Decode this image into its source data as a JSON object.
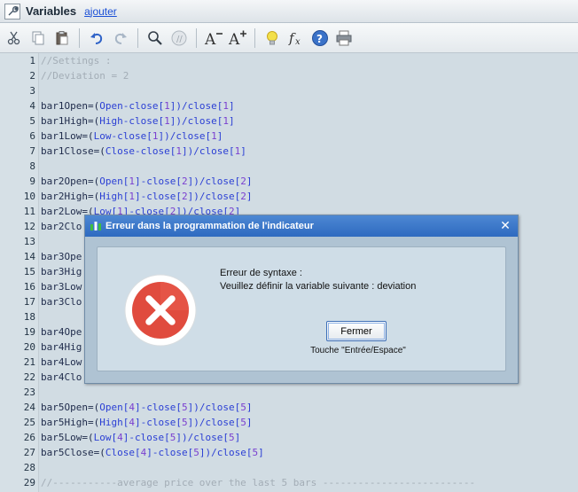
{
  "window": {
    "title": "Variables",
    "add_link": "ajouter"
  },
  "toolbar": {
    "buttons": [
      {
        "icon": "scissors-icon"
      },
      {
        "icon": "copy-icon"
      },
      {
        "icon": "paste-icon"
      },
      {
        "icon": "undo-icon"
      },
      {
        "icon": "redo-icon"
      },
      {
        "icon": "search-icon"
      },
      {
        "icon": "comment-icon"
      },
      {
        "icon": "font-decrease-icon",
        "text": "A"
      },
      {
        "icon": "font-increase-icon",
        "text": "A"
      },
      {
        "icon": "lightbulb-icon"
      },
      {
        "icon": "function-icon",
        "text": "fx"
      },
      {
        "icon": "help-icon",
        "text": "?"
      },
      {
        "icon": "print-icon"
      }
    ]
  },
  "colors": {
    "comment": "#a3adb6",
    "keyword": "#2b3fd4",
    "number": "#7a3fd0",
    "plain": "#1e2a4a",
    "dialog_title": "#3978cc",
    "error_red": "#e04b3e"
  },
  "editor": {
    "lines": [
      {
        "n": "1",
        "tokens": [
          {
            "t": "//Settings :",
            "c": "comment"
          }
        ]
      },
      {
        "n": "2",
        "tokens": [
          {
            "t": "//Deviation = 2",
            "c": "comment"
          }
        ]
      },
      {
        "n": "3",
        "tokens": []
      },
      {
        "n": "4",
        "tokens": [
          {
            "t": "bar1Open=(",
            "c": "plain"
          },
          {
            "t": "Open",
            "c": "keyword"
          },
          {
            "t": "-close[",
            "c": "keyword"
          },
          {
            "t": "1",
            "c": "number"
          },
          {
            "t": "])/close[",
            "c": "keyword"
          },
          {
            "t": "1",
            "c": "number"
          },
          {
            "t": "]",
            "c": "keyword"
          }
        ]
      },
      {
        "n": "5",
        "tokens": [
          {
            "t": "bar1High=(",
            "c": "plain"
          },
          {
            "t": "High",
            "c": "keyword"
          },
          {
            "t": "-close[",
            "c": "keyword"
          },
          {
            "t": "1",
            "c": "number"
          },
          {
            "t": "])/close[",
            "c": "keyword"
          },
          {
            "t": "1",
            "c": "number"
          },
          {
            "t": "]",
            "c": "keyword"
          }
        ]
      },
      {
        "n": "6",
        "tokens": [
          {
            "t": "bar1Low=(",
            "c": "plain"
          },
          {
            "t": "Low",
            "c": "keyword"
          },
          {
            "t": "-close[",
            "c": "keyword"
          },
          {
            "t": "1",
            "c": "number"
          },
          {
            "t": "])/close[",
            "c": "keyword"
          },
          {
            "t": "1",
            "c": "number"
          },
          {
            "t": "]",
            "c": "keyword"
          }
        ]
      },
      {
        "n": "7",
        "tokens": [
          {
            "t": "bar1Close=(",
            "c": "plain"
          },
          {
            "t": "Close",
            "c": "keyword"
          },
          {
            "t": "-close[",
            "c": "keyword"
          },
          {
            "t": "1",
            "c": "number"
          },
          {
            "t": "])/close[",
            "c": "keyword"
          },
          {
            "t": "1",
            "c": "number"
          },
          {
            "t": "]",
            "c": "keyword"
          }
        ]
      },
      {
        "n": "8",
        "tokens": []
      },
      {
        "n": "9",
        "tokens": [
          {
            "t": "bar2Open=(",
            "c": "plain"
          },
          {
            "t": "Open[",
            "c": "keyword"
          },
          {
            "t": "1",
            "c": "number"
          },
          {
            "t": "]-close[",
            "c": "keyword"
          },
          {
            "t": "2",
            "c": "number"
          },
          {
            "t": "])/close[",
            "c": "keyword"
          },
          {
            "t": "2",
            "c": "number"
          },
          {
            "t": "]",
            "c": "keyword"
          }
        ]
      },
      {
        "n": "10",
        "tokens": [
          {
            "t": "bar2High=(",
            "c": "plain"
          },
          {
            "t": "High[",
            "c": "keyword"
          },
          {
            "t": "1",
            "c": "number"
          },
          {
            "t": "]-close[",
            "c": "keyword"
          },
          {
            "t": "2",
            "c": "number"
          },
          {
            "t": "])/close[",
            "c": "keyword"
          },
          {
            "t": "2",
            "c": "number"
          },
          {
            "t": "]",
            "c": "keyword"
          }
        ]
      },
      {
        "n": "11",
        "tokens": [
          {
            "t": "bar2Low=(",
            "c": "plain"
          },
          {
            "t": "Low[",
            "c": "keyword"
          },
          {
            "t": "1",
            "c": "number"
          },
          {
            "t": "]-close[",
            "c": "keyword"
          },
          {
            "t": "2",
            "c": "number"
          },
          {
            "t": "])/close[",
            "c": "keyword"
          },
          {
            "t": "2",
            "c": "number"
          },
          {
            "t": "]",
            "c": "keyword"
          }
        ]
      },
      {
        "n": "12",
        "tokens": [
          {
            "t": "bar2Clo",
            "c": "plain"
          }
        ]
      },
      {
        "n": "13",
        "tokens": []
      },
      {
        "n": "14",
        "tokens": [
          {
            "t": "bar3Ope",
            "c": "plain"
          }
        ]
      },
      {
        "n": "15",
        "tokens": [
          {
            "t": "bar3Hig",
            "c": "plain"
          }
        ]
      },
      {
        "n": "16",
        "tokens": [
          {
            "t": "bar3Low",
            "c": "plain"
          }
        ]
      },
      {
        "n": "17",
        "tokens": [
          {
            "t": "bar3Clo",
            "c": "plain"
          }
        ]
      },
      {
        "n": "18",
        "tokens": []
      },
      {
        "n": "19",
        "tokens": [
          {
            "t": "bar4Ope",
            "c": "plain"
          }
        ]
      },
      {
        "n": "20",
        "tokens": [
          {
            "t": "bar4Hig",
            "c": "plain"
          }
        ]
      },
      {
        "n": "21",
        "tokens": [
          {
            "t": "bar4Low",
            "c": "plain"
          }
        ]
      },
      {
        "n": "22",
        "tokens": [
          {
            "t": "bar4Clo",
            "c": "plain"
          }
        ]
      },
      {
        "n": "23",
        "tokens": []
      },
      {
        "n": "24",
        "tokens": [
          {
            "t": "bar5Open=(",
            "c": "plain"
          },
          {
            "t": "Open[",
            "c": "keyword"
          },
          {
            "t": "4",
            "c": "number"
          },
          {
            "t": "]-close[",
            "c": "keyword"
          },
          {
            "t": "5",
            "c": "number"
          },
          {
            "t": "])/close[",
            "c": "keyword"
          },
          {
            "t": "5",
            "c": "number"
          },
          {
            "t": "]",
            "c": "keyword"
          }
        ]
      },
      {
        "n": "25",
        "tokens": [
          {
            "t": "bar5High=(",
            "c": "plain"
          },
          {
            "t": "High[",
            "c": "keyword"
          },
          {
            "t": "4",
            "c": "number"
          },
          {
            "t": "]-close[",
            "c": "keyword"
          },
          {
            "t": "5",
            "c": "number"
          },
          {
            "t": "])/close[",
            "c": "keyword"
          },
          {
            "t": "5",
            "c": "number"
          },
          {
            "t": "]",
            "c": "keyword"
          }
        ]
      },
      {
        "n": "26",
        "tokens": [
          {
            "t": "bar5Low=(",
            "c": "plain"
          },
          {
            "t": "Low[",
            "c": "keyword"
          },
          {
            "t": "4",
            "c": "number"
          },
          {
            "t": "]-close[",
            "c": "keyword"
          },
          {
            "t": "5",
            "c": "number"
          },
          {
            "t": "])/close[",
            "c": "keyword"
          },
          {
            "t": "5",
            "c": "number"
          },
          {
            "t": "]",
            "c": "keyword"
          }
        ]
      },
      {
        "n": "27",
        "tokens": [
          {
            "t": "bar5Close=(",
            "c": "plain"
          },
          {
            "t": "Close[",
            "c": "keyword"
          },
          {
            "t": "4",
            "c": "number"
          },
          {
            "t": "]-close[",
            "c": "keyword"
          },
          {
            "t": "5",
            "c": "number"
          },
          {
            "t": "])/close[",
            "c": "keyword"
          },
          {
            "t": "5",
            "c": "number"
          },
          {
            "t": "]",
            "c": "keyword"
          }
        ]
      },
      {
        "n": "28",
        "tokens": []
      },
      {
        "n": "29",
        "tokens": [
          {
            "t": "//-----------average price over the last 5 bars --------------------------",
            "c": "comment"
          }
        ]
      }
    ]
  },
  "dialog": {
    "title": "Erreur dans la programmation de l'indicateur",
    "message_line1": "Erreur de syntaxe :",
    "message_line2": "Veuillez définir la variable suivante : deviation",
    "button_label": "Fermer",
    "hint": "Touche \"Entrée/Espace\""
  }
}
